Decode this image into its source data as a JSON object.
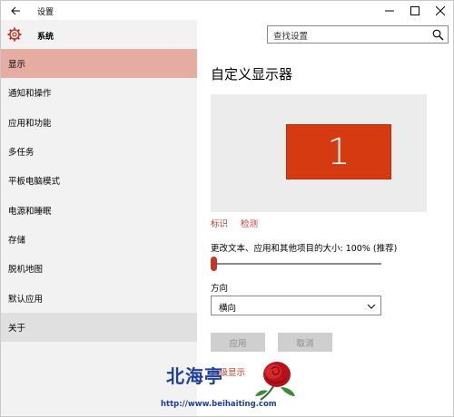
{
  "window": {
    "title": "设置"
  },
  "sidebar": {
    "title": "系统",
    "items": [
      {
        "label": "显示",
        "state": "active"
      },
      {
        "label": "通知和操作",
        "state": "normal"
      },
      {
        "label": "应用和功能",
        "state": "normal"
      },
      {
        "label": "多任务",
        "state": "normal"
      },
      {
        "label": "平板电脑模式",
        "state": "normal"
      },
      {
        "label": "电源和睡眠",
        "state": "normal"
      },
      {
        "label": "存储",
        "state": "normal"
      },
      {
        "label": "脱机地图",
        "state": "normal"
      },
      {
        "label": "默认应用",
        "state": "normal"
      },
      {
        "label": "关于",
        "state": "hover"
      }
    ]
  },
  "search": {
    "placeholder": "查找设置"
  },
  "main": {
    "title": "自定义显示器",
    "monitor_number": "1",
    "identify_link": "标识",
    "detect_link": "检测",
    "scale_label": "更改文本、应用和其他项目的大小: 100% (推荐)",
    "scale_fraction": 0.0,
    "orientation_label": "方向",
    "orientation_value": "横向",
    "apply_button": "应用",
    "cancel_button": "取消",
    "partial_link": "高级显示"
  },
  "watermark": {
    "text": "北海亭",
    "url": "http://www.beihaiting.com"
  },
  "colors": {
    "accent": "#c0392b",
    "monitor": "#d53a10",
    "active_nav": "#e5ada1",
    "watermark": "#1f3d9a"
  }
}
